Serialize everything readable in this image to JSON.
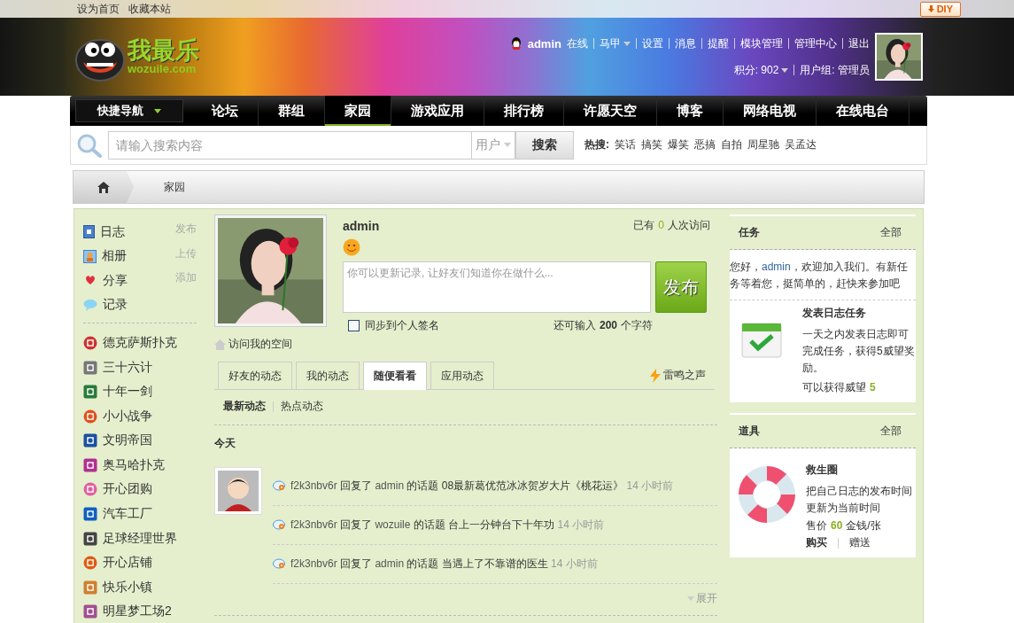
{
  "topbar": {
    "links": [
      "设为首页",
      "收藏本站"
    ],
    "diy": "DIY"
  },
  "header": {
    "logo": {
      "text": "我最乐",
      "sub": "wozuile.com"
    },
    "user": {
      "name": "admin",
      "status": "在线"
    },
    "menu": [
      {
        "label": "马甲",
        "dropdown": true
      },
      {
        "label": "设置",
        "dropdown": false
      },
      {
        "label": "消息",
        "dropdown": false
      },
      {
        "label": "提醒",
        "dropdown": false
      },
      {
        "label": "模块管理",
        "dropdown": false
      },
      {
        "label": "管理中心",
        "dropdown": false
      },
      {
        "label": "退出",
        "dropdown": false
      }
    ],
    "points": "积分: 902",
    "group": "用户组: 管理员"
  },
  "nav": {
    "quick": "快捷导航",
    "items": [
      {
        "label": "论坛",
        "selected": false
      },
      {
        "label": "群组",
        "selected": false
      },
      {
        "label": "家园",
        "selected": true
      },
      {
        "label": "游戏应用",
        "selected": false
      },
      {
        "label": "排行榜",
        "selected": false
      },
      {
        "label": "许愿天空",
        "selected": false
      },
      {
        "label": "博客",
        "selected": false
      },
      {
        "label": "网络电视",
        "selected": false
      },
      {
        "label": "在线电台",
        "selected": false
      }
    ]
  },
  "search": {
    "placeholder": "请输入搜索内容",
    "scope": "用户",
    "button": "搜索",
    "hot_label": "热搜:",
    "hot": [
      "笑话",
      "搞笑",
      "爆笑",
      "恶搞",
      "自拍",
      "周星驰",
      "吴孟达"
    ]
  },
  "breadcrumb": {
    "current": "家园"
  },
  "sidebar": {
    "items": [
      {
        "label": "日志",
        "action": "发布"
      },
      {
        "label": "相册",
        "action": "上传"
      },
      {
        "label": "分享",
        "action": "添加"
      },
      {
        "label": "记录"
      }
    ],
    "apps": [
      "德克萨斯扑克",
      "三十六计",
      "十年一剑",
      "小小战争",
      "文明帝国",
      "奥马哈扑克",
      "开心团购",
      "汽车工厂",
      "足球经理世界",
      "开心店铺",
      "快乐小镇",
      "明星梦工场2"
    ]
  },
  "profile": {
    "name": "admin",
    "visits": {
      "prefix": "已有",
      "count": "0",
      "suffix": "人次访问"
    },
    "status_placeholder": "你可以更新记录, 让好友们知道你在做什么...",
    "publish": "发布",
    "sync": {
      "label": "同步到个人签名",
      "checked": false
    },
    "remaining": {
      "prefix": "还可输入",
      "count": "200",
      "suffix": "个字符"
    },
    "visit_link": "访问我的空间"
  },
  "tabs": [
    {
      "label": "好友的动态",
      "selected": false
    },
    {
      "label": "我的动态",
      "selected": false
    },
    {
      "label": "随便看看",
      "selected": true
    },
    {
      "label": "应用动态",
      "selected": false
    }
  ],
  "tabs_extra": "雷鸣之声",
  "subtabs": [
    {
      "label": "最新动态",
      "selected": true
    },
    {
      "label": "热点动态",
      "selected": false
    }
  ],
  "feed": {
    "day": "今天",
    "entries": [
      {
        "user": "f2k3nbv6r",
        "verb": "回复了",
        "owner": "admin",
        "object": "的话题",
        "title": "08最新葛优范冰冰贺岁大片《桃花运》",
        "time": "14 小时前"
      },
      {
        "user": "f2k3nbv6r",
        "verb": "回复了",
        "owner": "wozuile",
        "object": "的话题",
        "title": "台上一分钟台下十年功",
        "time": "14 小时前"
      },
      {
        "user": "f2k3nbv6r",
        "verb": "回复了",
        "owner": "admin",
        "object": "的话题",
        "title": "当遇上了不靠谱的医生",
        "time": "14 小时前"
      }
    ],
    "expand": "展开"
  },
  "tasks": {
    "title": "任务",
    "all": "全部",
    "greeting": {
      "before": "您好，",
      "user": "admin",
      "after": "，欢迎加入我们。有新任务等着您，挺简单的，赶快来参加吧"
    },
    "task": {
      "name": "发表日志任务",
      "desc": "一天之内发表日志即可完成任务，获得5威望奖励。",
      "reward_label": "可以获得威望",
      "reward": "5"
    }
  },
  "tools": {
    "title": "道具",
    "all": "全部",
    "item": {
      "name": "救生圈",
      "desc": "把自己日志的发布时间更新为当前时间",
      "price_label": "售价",
      "price": "60",
      "unit": "金钱/张",
      "buy": "购买",
      "gift": "赠送"
    }
  }
}
